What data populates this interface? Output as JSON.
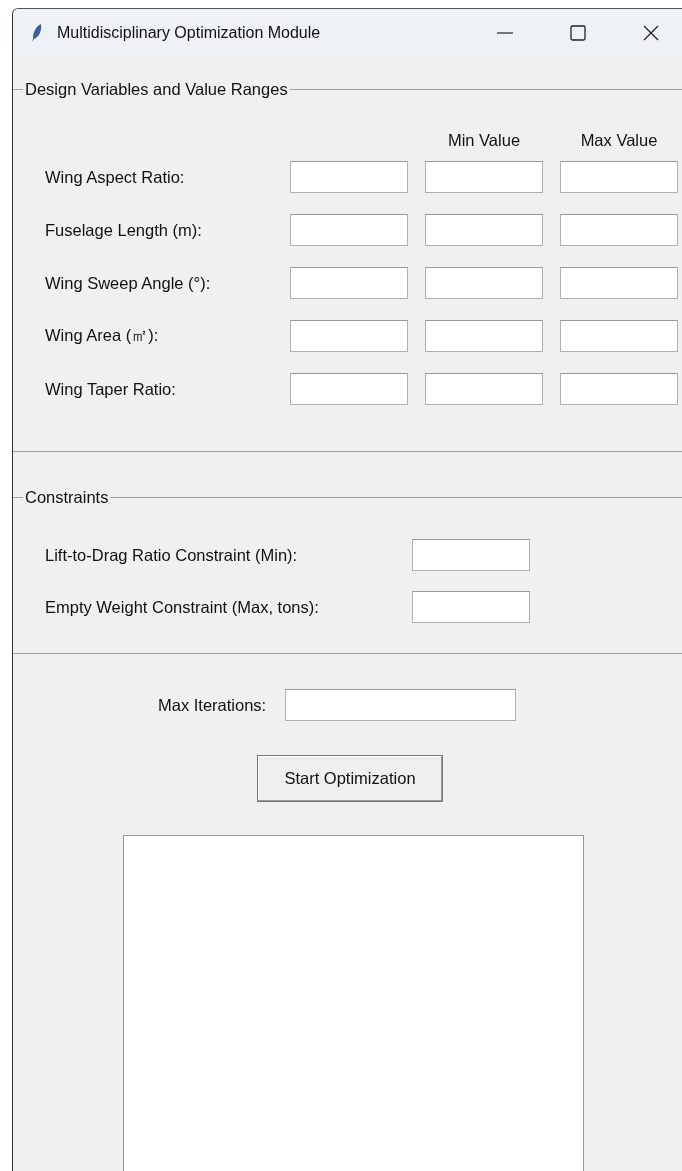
{
  "window": {
    "title": "Multidisciplinary Optimization Module"
  },
  "design_variables": {
    "title": "Design Variables and Value Ranges",
    "columns": [
      "Min Value",
      "Max Value"
    ],
    "rows": [
      {
        "label": "Wing Aspect Ratio:"
      },
      {
        "label": "Fuselage Length (m):"
      },
      {
        "label": "Wing Sweep Angle (°):"
      },
      {
        "label": "Wing Area (㎡):"
      },
      {
        "label": "Wing Taper Ratio:"
      }
    ]
  },
  "constraints": {
    "title": "Constraints",
    "rows": [
      {
        "label": "Lift-to-Drag Ratio Constraint (Min):"
      },
      {
        "label": "Empty Weight Constraint (Max, tons):"
      }
    ]
  },
  "max_iterations": {
    "label": "Max Iterations:"
  },
  "start_button": "Start Optimization"
}
